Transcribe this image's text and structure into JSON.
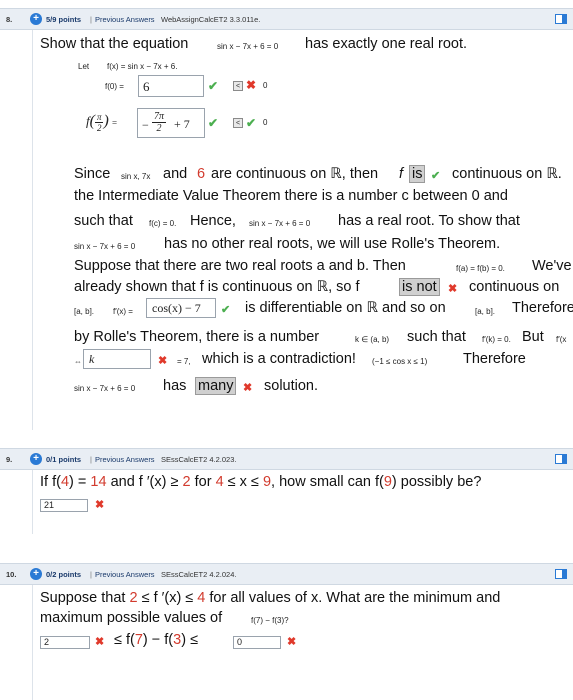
{
  "q8": {
    "number": "8.",
    "points": "5/9 points",
    "prev": "Previous Answers",
    "source": "WebAssignCalcET2 3.3.011e.",
    "prompt_a": "Show that the equation",
    "prompt_eq": "sin x − 7x + 6 = 0",
    "prompt_b": "has exactly one real root.",
    "let_label": "Let",
    "let_def": "f(x) = sin x − 7x + 6.",
    "f0_label": "f(0) =",
    "f0_value": "6",
    "f0_score": "0",
    "fpi_score": "0",
    "fpi_answer_const": "+ 7",
    "l1_a": "Since",
    "l1_fn": "sin x, 7x",
    "l1_b": "and",
    "l1_num": "6",
    "l1_c": "are continuous on ℝ, then",
    "l1_f": "f",
    "l1_sel": "is",
    "l1_d": "continuous on ℝ.",
    "l2": "the Intermediate Value Theorem there is a number c between 0 and",
    "l3_a": "such that",
    "l3_eq": "f(c) = 0.",
    "l3_b": "Hence,",
    "l3_eq2": "sin x − 7x + 6 = 0",
    "l3_c": "has a real root. To show that",
    "l4_eq": "sin x − 7x + 6 = 0",
    "l4_b": "has no other real roots, we will use Rolle's Theorem.",
    "l5_a": "Suppose that there are two real roots a and b. Then",
    "l5_eq": "f(a) = f(b) = 0.",
    "l5_b": "We've",
    "l6_a": "already shown that f is continuous on ℝ, so f",
    "l6_sel": "is not",
    "l6_b": "continuous on",
    "l7_a": "[a, b].",
    "l7_fp": "f′(x) =",
    "l7_ans": "cos(x) − 7",
    "l7_b": "is differentiable on ℝ and so on",
    "l7_c": "[a, b].",
    "l7_d": "Therefore",
    "l8_a": "by Rolle's Theorem, there is a number",
    "l8_eq": "k ∈ (a, b)",
    "l8_b": "such that",
    "l8_eq2": "f′(k) = 0.",
    "l8_c": "But",
    "l8_d": "f′(x",
    "l9_arrow": "⇔",
    "l9_ans": "k",
    "l9_eq": "= 7,",
    "l9_b": "which is a contradiction!",
    "l9_eq2": "(−1 ≤ cos x ≤ 1)",
    "l9_c": "Therefore",
    "l10_eq": "sin x − 7x + 6 = 0",
    "l10_b": "has",
    "l10_sel": "many",
    "l10_c": "solution."
  },
  "q9": {
    "number": "9.",
    "points": "0/1 points",
    "prev": "Previous Answers",
    "source": "SEssCalcET2 4.2.023.",
    "text_a": "If f(",
    "n1": "4",
    "text_b": ") =",
    "n2": "14",
    "text_c": "and f ′(x) ≥",
    "n3": "2",
    "text_d": "for",
    "n4": "4",
    "text_e": "≤ x ≤",
    "n5": "9",
    "text_f": ", how small can f(",
    "n6": "9",
    "text_g": ") possibly be?",
    "answer": "21"
  },
  "q10": {
    "number": "10.",
    "points": "0/2 points",
    "prev": "Previous Answers",
    "source": "SEssCalcET2 4.2.024.",
    "text_a": "Suppose that",
    "n1": "2",
    "text_b": "≤ f ′(x) ≤",
    "n2": "4",
    "text_c": "for all values of x. What are the minimum and",
    "line2_a": "maximum possible values of",
    "line2_eq": "f(7) − f(3)?",
    "ans1": "2",
    "mid_a": "≤ f(",
    "n3": "7",
    "mid_b": ") − f(",
    "n4": "3",
    "mid_c": ") ≤",
    "ans2": "0"
  },
  "colors": {
    "check": "#4caf50",
    "cross": "#e0392b",
    "accent": "#2a7ad5",
    "red_number": "#d23b2e"
  }
}
